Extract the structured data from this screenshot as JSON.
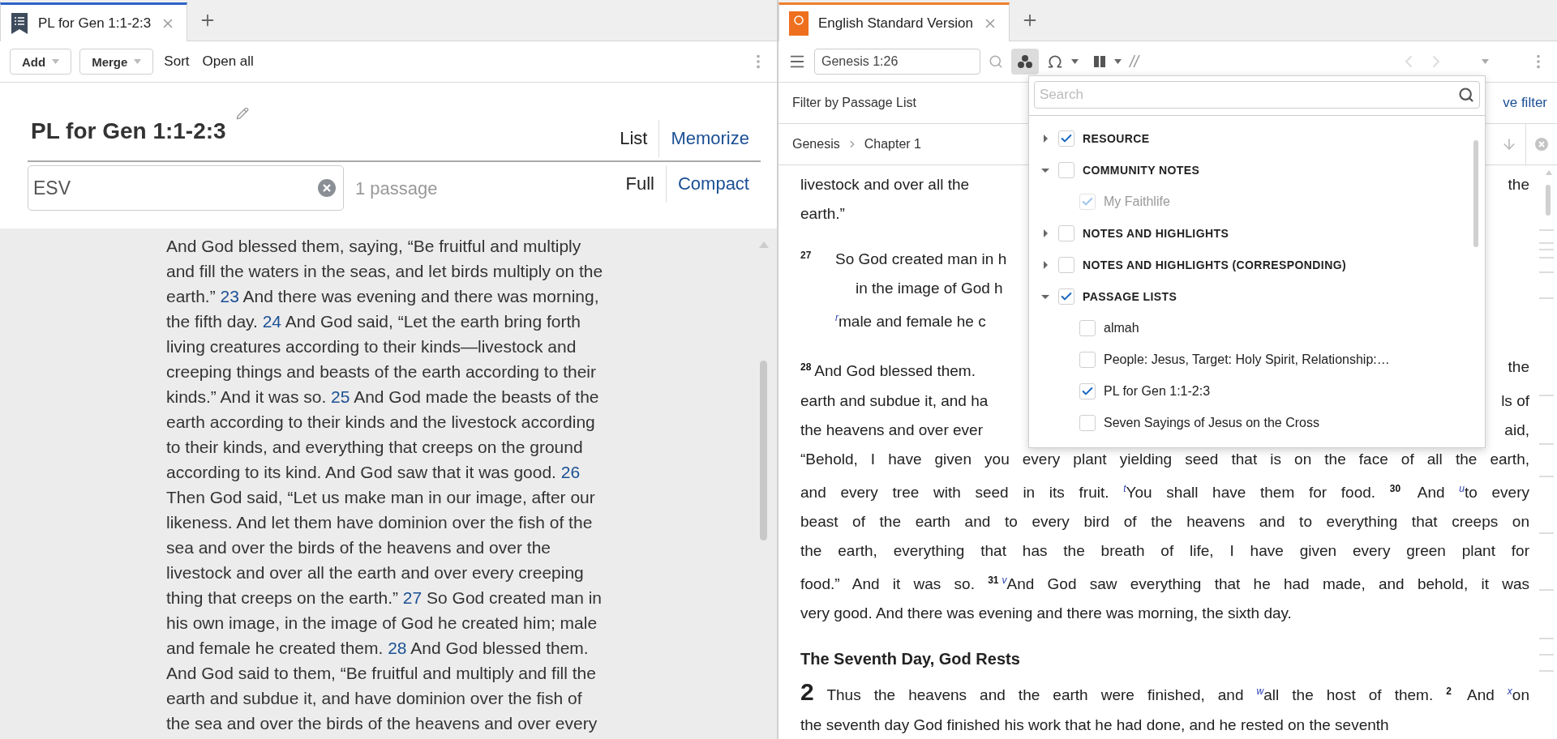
{
  "left_pane": {
    "tab": {
      "title": "PL for Gen 1:1-2:3",
      "selected": true
    },
    "toolbar": {
      "menu_buttons": [
        "Add",
        "Merge"
      ],
      "text_buttons": [
        "Sort",
        "Open all"
      ]
    },
    "header": {
      "title": "PL for Gen 1:1-2:3",
      "view_modes": [
        {
          "label": "List",
          "selected": true
        },
        {
          "label": "Memorize",
          "selected": false
        }
      ],
      "filter": {
        "value": "ESV"
      },
      "count": "1 passage",
      "density": [
        {
          "label": "Full",
          "selected": true
        },
        {
          "label": "Compact",
          "selected": false
        }
      ]
    },
    "passage_lines": [
      [
        {
          "kind": "text",
          "text": "And God blessed them, saying, “Be fruitful and multiply"
        }
      ],
      [
        {
          "kind": "text",
          "text": "and fill the waters in the seas, and let birds multiply on the"
        }
      ],
      [
        {
          "kind": "text",
          "text": "earth.” "
        },
        {
          "kind": "verse",
          "text": "23"
        },
        {
          "kind": "text",
          "text": " And there was evening and there was morning,"
        }
      ],
      [
        {
          "kind": "text",
          "text": "the fifth day. "
        },
        {
          "kind": "verse",
          "text": "24"
        },
        {
          "kind": "text",
          "text": " And God said, “Let the earth bring forth"
        }
      ],
      [
        {
          "kind": "text",
          "text": "living creatures according to their kinds—livestock and"
        }
      ],
      [
        {
          "kind": "text",
          "text": "creeping things and beasts of the earth according to their"
        }
      ],
      [
        {
          "kind": "text",
          "text": "kinds.” And it was so. "
        },
        {
          "kind": "verse",
          "text": "25"
        },
        {
          "kind": "text",
          "text": " And God made the beasts of the"
        }
      ],
      [
        {
          "kind": "text",
          "text": "earth according to their kinds and the livestock according"
        }
      ],
      [
        {
          "kind": "text",
          "text": "to their kinds, and everything that creeps on the ground"
        }
      ],
      [
        {
          "kind": "text",
          "text": "according to its kind. And God saw that it was good. "
        },
        {
          "kind": "verse",
          "text": "26"
        }
      ],
      [
        {
          "kind": "text",
          "text": "Then God said, “Let us make man in our image, after our"
        }
      ],
      [
        {
          "kind": "text",
          "text": "likeness. And let them have dominion over the fish of the"
        }
      ],
      [
        {
          "kind": "text",
          "text": "sea and over the birds of the heavens and over the"
        }
      ],
      [
        {
          "kind": "text",
          "text": "livestock and over all the earth and over every creeping"
        }
      ],
      [
        {
          "kind": "text",
          "text": "thing that creeps on the earth.” "
        },
        {
          "kind": "verse",
          "text": "27"
        },
        {
          "kind": "text",
          "text": " So God created man in"
        }
      ],
      [
        {
          "kind": "text",
          "text": "his own image, in the image of God he created him; male"
        }
      ],
      [
        {
          "kind": "text",
          "text": "and female he created them. "
        },
        {
          "kind": "verse",
          "text": "28"
        },
        {
          "kind": "text",
          "text": " And God blessed them."
        }
      ],
      [
        {
          "kind": "text",
          "text": "And God said to them, “Be fruitful and multiply and fill the"
        }
      ],
      [
        {
          "kind": "text",
          "text": "earth and subdue it, and have dominion over the fish of"
        }
      ],
      [
        {
          "kind": "text",
          "text": "the sea and over the birds of the heavens and over every"
        }
      ]
    ]
  },
  "right_pane": {
    "tab": {
      "title": "English Standard Version",
      "selected": true
    },
    "toolbar": {
      "reference": "Genesis 1:26",
      "filter_active": true,
      "separator_text": "//"
    },
    "filter_bar": {
      "label": "Filter by Passage List",
      "action": "ve filter"
    },
    "breadcrumb": [
      "Genesis",
      "Chapter 1"
    ],
    "paragraphs": [
      {
        "kind": "prose",
        "lines": [
          {
            "left": [
              {
                "kind": "text",
                "text": "livestock and over all the"
              }
            ],
            "right": [
              {
                "kind": "text",
                "text": "the"
              }
            ]
          },
          {
            "left": [
              {
                "kind": "text",
                "text": "earth.”"
              }
            ]
          }
        ]
      },
      {
        "kind": "poetry",
        "lines": [
          {
            "indent": false,
            "left": [
              {
                "kind": "verse",
                "text": "27"
              },
              {
                "kind": "text",
                "text": "So God created man in h"
              }
            ]
          },
          {
            "indent": true,
            "left": [
              {
                "kind": "text",
                "text": "in the image of God h"
              }
            ]
          },
          {
            "indent": false,
            "left": [
              {
                "kind": "note",
                "text": "r"
              },
              {
                "kind": "text",
                "text": "male and female he c"
              }
            ]
          }
        ]
      },
      {
        "kind": "prose",
        "lines": [
          {
            "left": [
              {
                "kind": "verse",
                "text": "28"
              },
              {
                "kind": "text",
                "text": "And God blessed them."
              }
            ],
            "right": [
              {
                "kind": "text",
                "text": "the"
              }
            ]
          },
          {
            "left": [
              {
                "kind": "text",
                "text": "earth and subdue it, and ha"
              }
            ],
            "right": [
              {
                "kind": "text",
                "text": "ls of"
              }
            ]
          },
          {
            "left": [
              {
                "kind": "text",
                "text": "the heavens and over ever"
              }
            ],
            "right": [
              {
                "kind": "text",
                "text": "aid,"
              }
            ]
          },
          {
            "left": [
              {
                "kind": "text",
                "text": "“Behold, I have given you every plant yielding seed that is on the face of all the earth,"
              }
            ]
          },
          {
            "left": [
              {
                "kind": "text",
                "text": "and every tree with seed in its fruit. "
              },
              {
                "kind": "note",
                "text": "t"
              },
              {
                "kind": "text",
                "text": "You shall have them for food. "
              },
              {
                "kind": "verse",
                "text": "30"
              },
              {
                "kind": "text",
                "text": " And "
              },
              {
                "kind": "note",
                "text": "u"
              },
              {
                "kind": "text",
                "text": "to every"
              }
            ]
          },
          {
            "left": [
              {
                "kind": "text",
                "text": "beast of the earth and to every bird of the heavens and to everything that creeps on"
              }
            ]
          },
          {
            "left": [
              {
                "kind": "text",
                "text": "the earth, everything that has the breath of life, I have given every green plant for"
              }
            ]
          },
          {
            "left": [
              {
                "kind": "text",
                "text": "food.” And it was so. "
              },
              {
                "kind": "verse",
                "text": "31"
              },
              {
                "kind": "note",
                "text": "v"
              },
              {
                "kind": "text",
                "text": "And God saw everything that he had made, and behold, it was"
              }
            ]
          },
          {
            "left": [
              {
                "kind": "text",
                "text": "very good. And there was evening and there was morning, the sixth day."
              }
            ]
          }
        ]
      },
      {
        "kind": "heading",
        "text": "The Seventh Day, God Rests"
      },
      {
        "kind": "prose",
        "lines": [
          {
            "left": [
              {
                "kind": "chapter",
                "text": "2"
              },
              {
                "kind": "text",
                "text": " Thus the heavens and the earth were finished, and "
              },
              {
                "kind": "note",
                "text": "w"
              },
              {
                "kind": "text",
                "text": "all the host of them. "
              },
              {
                "kind": "verse",
                "text": "2"
              },
              {
                "kind": "text",
                "text": " And "
              },
              {
                "kind": "note",
                "text": "x"
              },
              {
                "kind": "text",
                "text": "on"
              }
            ]
          },
          {
            "left": [
              {
                "kind": "text",
                "text": "the seventh day God finished his work that he had done, and he rested on the seventh"
              }
            ]
          }
        ]
      }
    ],
    "dropdown": {
      "search": {
        "placeholder": "Search"
      },
      "groups": [
        {
          "label": "RESOURCE",
          "checked": true,
          "expanded": false
        },
        {
          "label": "COMMUNITY NOTES",
          "checked": false,
          "expanded": true,
          "children": [
            {
              "label": "My Faithlife",
              "checked": true,
              "disabled": true
            }
          ]
        },
        {
          "label": "NOTES AND HIGHLIGHTS",
          "checked": false,
          "expanded": false
        },
        {
          "label": "NOTES AND HIGHLIGHTS (CORRESPONDING)",
          "checked": false,
          "expanded": false
        },
        {
          "label": "PASSAGE LISTS",
          "checked": true,
          "expanded": true,
          "children": [
            {
              "label": "almah",
              "checked": false,
              "disabled": false
            },
            {
              "label": "People: Jesus, Target: Holy Spirit, Relationship:…",
              "checked": false,
              "disabled": false
            },
            {
              "label": "PL for Gen 1:1-2:3",
              "checked": true,
              "disabled": false
            },
            {
              "label": "Seven Sayings of Jesus on the Cross",
              "checked": false,
              "disabled": false
            }
          ]
        }
      ]
    }
  }
}
